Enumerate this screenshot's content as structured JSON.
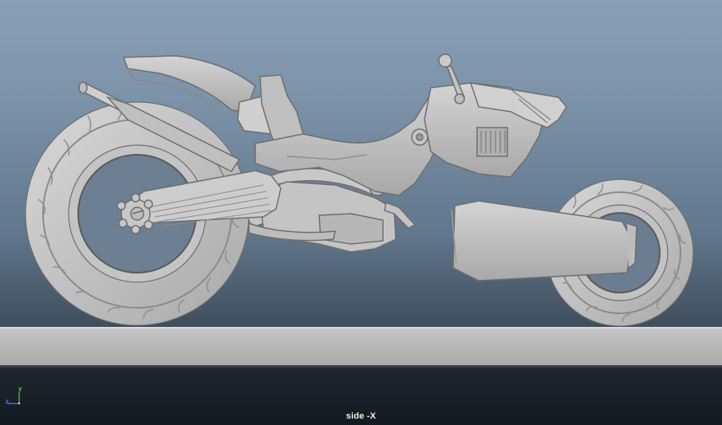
{
  "viewport": {
    "camera_label": "side -X",
    "background_top": "#89a0b6",
    "background_bottom": "#141a20",
    "model_shading": "#c9c9c9"
  },
  "axis_gizmo": {
    "y_label": "y",
    "z_label": "z",
    "y_color": "#4cd24c",
    "z_color": "#5a7cff"
  }
}
